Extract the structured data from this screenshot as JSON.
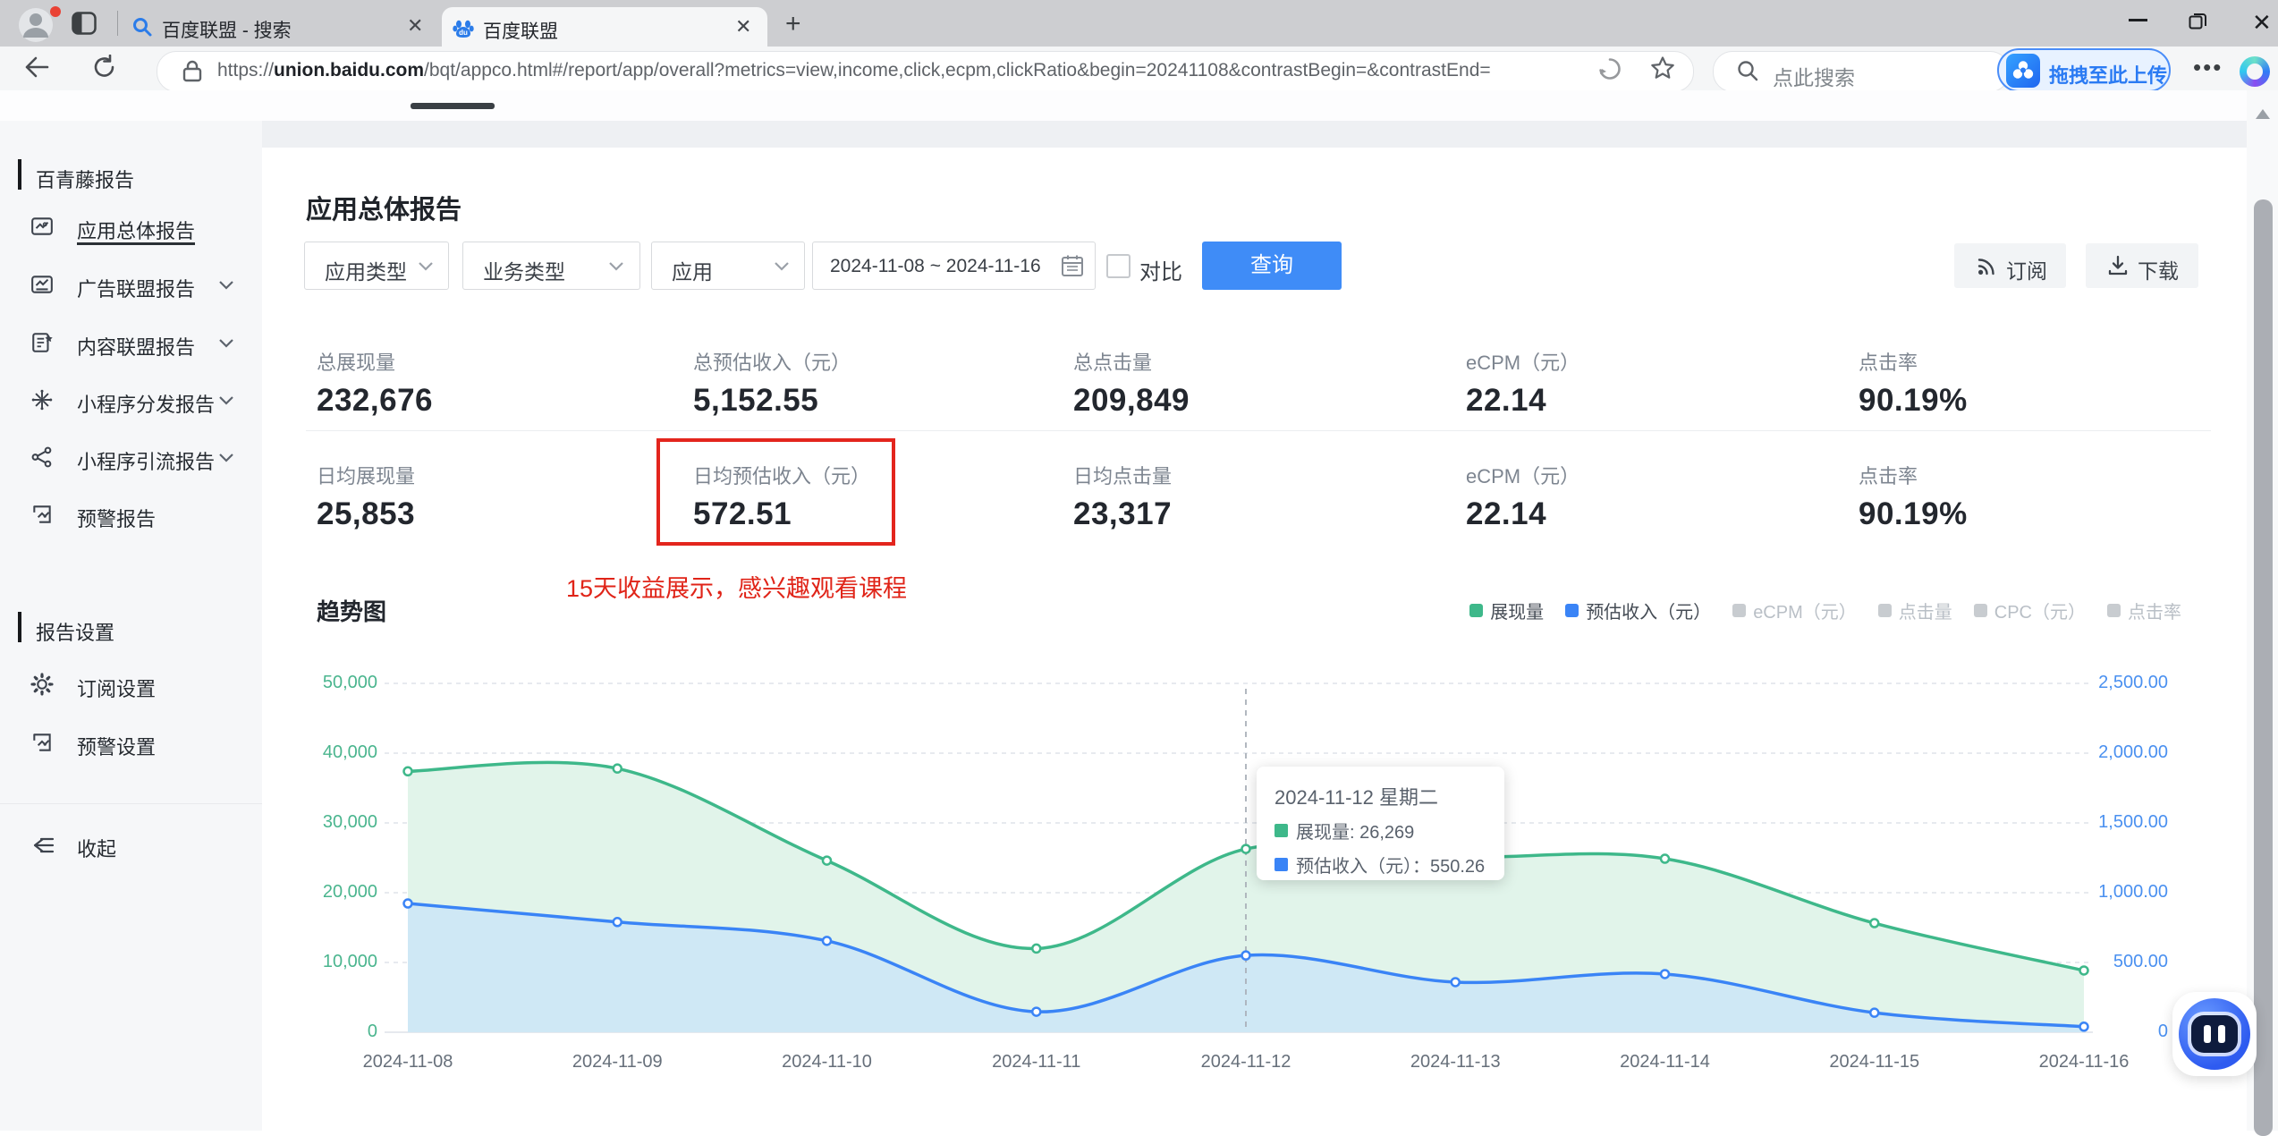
{
  "browser": {
    "tabs": [
      {
        "title": "百度联盟 - 搜索",
        "active": false
      },
      {
        "title": "百度联盟",
        "active": true
      }
    ],
    "url": {
      "prefix": "https://",
      "domain": "union.baidu.com",
      "path": "/bqt/appco.html#/report/app/overall?metrics=view,income,click,ecpm,clickRatio&begin=20241108&contrastBegin=&contrastEnd="
    },
    "search_placeholder": "点此搜索",
    "upload_label": "拖拽至此上传",
    "window_controls": {
      "minimize": "–",
      "restore": "",
      "close": "✕"
    }
  },
  "sidebar": {
    "section1": "百青藤报告",
    "items": [
      {
        "label": "应用总体报告",
        "icon": "report-icon",
        "selected": true,
        "chevron": false
      },
      {
        "label": "广告联盟报告",
        "icon": "ad-report-icon",
        "selected": false,
        "chevron": true
      },
      {
        "label": "内容联盟报告",
        "icon": "content-report-icon",
        "selected": false,
        "chevron": true
      },
      {
        "label": "小程序分发报告",
        "icon": "distribute-icon",
        "selected": false,
        "chevron": true
      },
      {
        "label": "小程序引流报告",
        "icon": "share-icon",
        "selected": false,
        "chevron": true
      },
      {
        "label": "预警报告",
        "icon": "alert-report-icon",
        "selected": false,
        "chevron": false
      }
    ],
    "section2": "报告设置",
    "items2": [
      {
        "label": "订阅设置",
        "icon": "gear-icon"
      },
      {
        "label": "预警设置",
        "icon": "alert-report-icon"
      }
    ],
    "collapse_label": "收起"
  },
  "main": {
    "title": "应用总体报告",
    "filters": {
      "app_type": "应用类型",
      "business_type": "业务类型",
      "app": "应用",
      "date_range": "2024-11-08 ~ 2024-11-16",
      "compare": "对比",
      "query": "查询",
      "subscribe": "订阅",
      "download": "下载"
    },
    "stats_total": [
      {
        "label": "总展现量",
        "value": "232,676"
      },
      {
        "label": "总预估收入（元）",
        "value": "5,152.55"
      },
      {
        "label": "总点击量",
        "value": "209,849"
      },
      {
        "label": "eCPM（元）",
        "value": "22.14"
      },
      {
        "label": "点击率",
        "value": "90.19%"
      }
    ],
    "stats_daily": [
      {
        "label": "日均展现量",
        "value": "25,853"
      },
      {
        "label": "日均预估收入（元）",
        "value": "572.51",
        "highlighted": true
      },
      {
        "label": "日均点击量",
        "value": "23,317"
      },
      {
        "label": "eCPM（元）",
        "value": "22.14"
      },
      {
        "label": "点击率",
        "value": "90.19%"
      }
    ],
    "annotation": "15天收益展示，感兴趣观看课程",
    "chart_title": "趋势图"
  },
  "chart_data": {
    "type": "area",
    "x": [
      "2024-11-08",
      "2024-11-09",
      "2024-11-10",
      "2024-11-11",
      "2024-11-12",
      "2024-11-13",
      "2024-11-14",
      "2024-11-15",
      "2024-11-16"
    ],
    "series": [
      {
        "name": "展现量",
        "axis": "left",
        "color": "#3eb88a",
        "fill": "#e1f4ea",
        "values": [
          37400,
          37800,
          24600,
          12000,
          26269,
          25100,
          24870,
          15640,
          8850
        ]
      },
      {
        "name": "预估收入（元）",
        "axis": "right",
        "color": "#3a84f6",
        "fill": "#cfe8f5",
        "values": [
          923,
          790,
          655,
          147,
          550.26,
          359,
          417,
          140,
          40
        ]
      }
    ],
    "y_left": {
      "max": 50000,
      "ticks": [
        "0",
        "10,000",
        "20,000",
        "30,000",
        "40,000",
        "50,000"
      ]
    },
    "y_right": {
      "max": 2500,
      "ticks": [
        "0",
        "500.00",
        "1,000.00",
        "1,500.00",
        "2,000.00",
        "2,500.00"
      ]
    },
    "legend": [
      {
        "label": "展现量",
        "color": "#3eb88a",
        "active": true
      },
      {
        "label": "预估收入（元）",
        "color": "#3a84f6",
        "active": true
      },
      {
        "label": "eCPM（元）",
        "color": "#c8ccd0",
        "active": false
      },
      {
        "label": "点击量",
        "color": "#c8ccd0",
        "active": false
      },
      {
        "label": "CPC（元）",
        "color": "#c8ccd0",
        "active": false
      },
      {
        "label": "点击率",
        "color": "#c8ccd0",
        "active": false
      }
    ],
    "grid": true,
    "tooltip": {
      "title": "2024-11-12 星期二",
      "rows": [
        {
          "color": "#3eb88a",
          "text": "展现量: 26,269"
        },
        {
          "color": "#3a84f6",
          "text": "预估收入（元）：550.26"
        }
      ],
      "x_index": 4
    }
  }
}
